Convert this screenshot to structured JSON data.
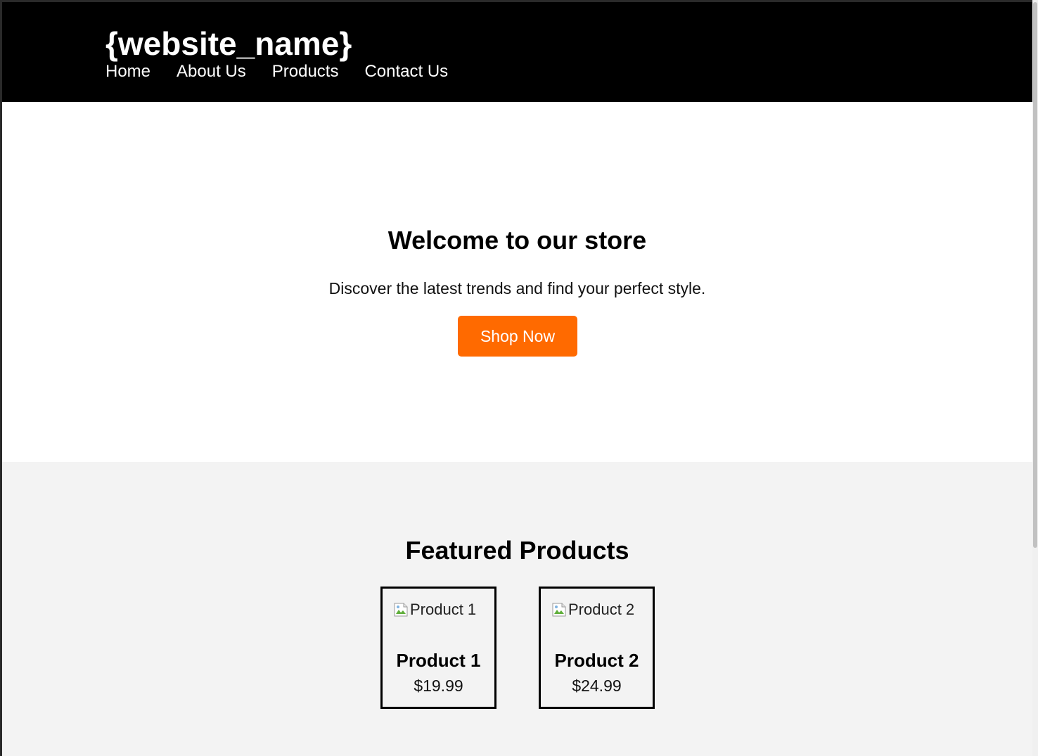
{
  "header": {
    "site_title": "{website_name}",
    "nav": [
      "Home",
      "About Us",
      "Products",
      "Contact Us"
    ]
  },
  "hero": {
    "title": "Welcome to our store",
    "subtitle": "Discover the latest trends and find your perfect style.",
    "button_label": "Shop Now",
    "button_color": "#ff6a00"
  },
  "featured": {
    "title": "Featured Products",
    "products": [
      {
        "image_alt": "Product 1",
        "name": "Product 1",
        "price": "$19.99"
      },
      {
        "image_alt": "Product 2",
        "name": "Product 2",
        "price": "$24.99"
      }
    ]
  },
  "icons": {
    "broken_image": "broken-image-icon"
  }
}
